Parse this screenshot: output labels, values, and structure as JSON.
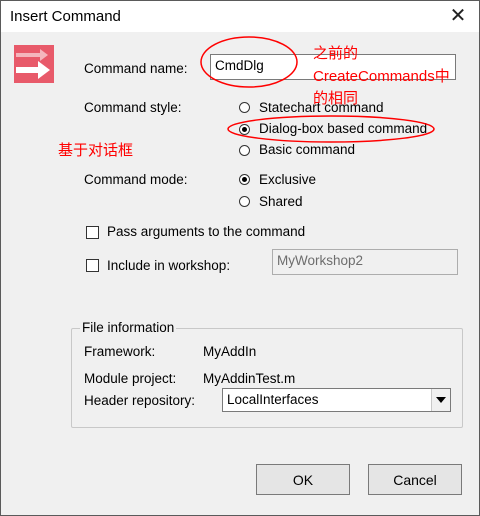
{
  "window": {
    "title": "Insert Command",
    "close_glyph": "✕"
  },
  "command_name": {
    "label": "Command name:",
    "value": "CmdDlg"
  },
  "command_style": {
    "label": "Command style:",
    "options": [
      "Statechart command",
      "Dialog-box based command",
      "Basic command"
    ],
    "selected_index": 1
  },
  "command_mode": {
    "label": "Command mode:",
    "options": [
      "Exclusive",
      "Shared"
    ],
    "selected_index": 0
  },
  "pass_arguments": {
    "label": "Pass arguments to the command",
    "checked": false
  },
  "include_workshop": {
    "label": "Include in workshop:",
    "checked": false,
    "value": "MyWorkshop2"
  },
  "file_info": {
    "title": "File information",
    "framework_label": "Framework:",
    "framework_value": "MyAddIn",
    "module_label": "Module project:",
    "module_value": "MyAddinTest.m",
    "header_label": "Header repository:",
    "header_value": "LocalInterfaces"
  },
  "buttons": {
    "ok": "OK",
    "cancel": "Cancel"
  },
  "annotations": {
    "note_line1": "之前的",
    "note_line2": "CreateCommands中",
    "note_line3": "的相同",
    "note_dialog": "基于对话框"
  },
  "icons": {
    "command_icon": "arrow-icon",
    "dropdown": "chevron-down-icon"
  },
  "colors": {
    "annotation": "#ff0000",
    "icon_bg": "#e85a6a"
  }
}
